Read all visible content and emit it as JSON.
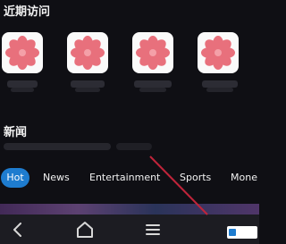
{
  "recent": {
    "title": "近期访问",
    "items": [
      {
        "icon": "flower-icon"
      },
      {
        "icon": "flower-icon"
      },
      {
        "icon": "flower-icon"
      },
      {
        "icon": "flower-icon"
      }
    ]
  },
  "news": {
    "title": "新闻",
    "tabs": [
      {
        "label": "Hot",
        "active": true
      },
      {
        "label": "News",
        "active": false
      },
      {
        "label": "Entertainment",
        "active": false
      },
      {
        "label": "Sports",
        "active": false
      },
      {
        "label": "Mone",
        "active": false
      }
    ]
  },
  "navbar": {
    "items": [
      "back-icon",
      "home-icon",
      "menu-icon"
    ]
  },
  "colors": {
    "background": "#0f0f14",
    "accent": "#1e7ccf",
    "flower": "#e8707c"
  }
}
